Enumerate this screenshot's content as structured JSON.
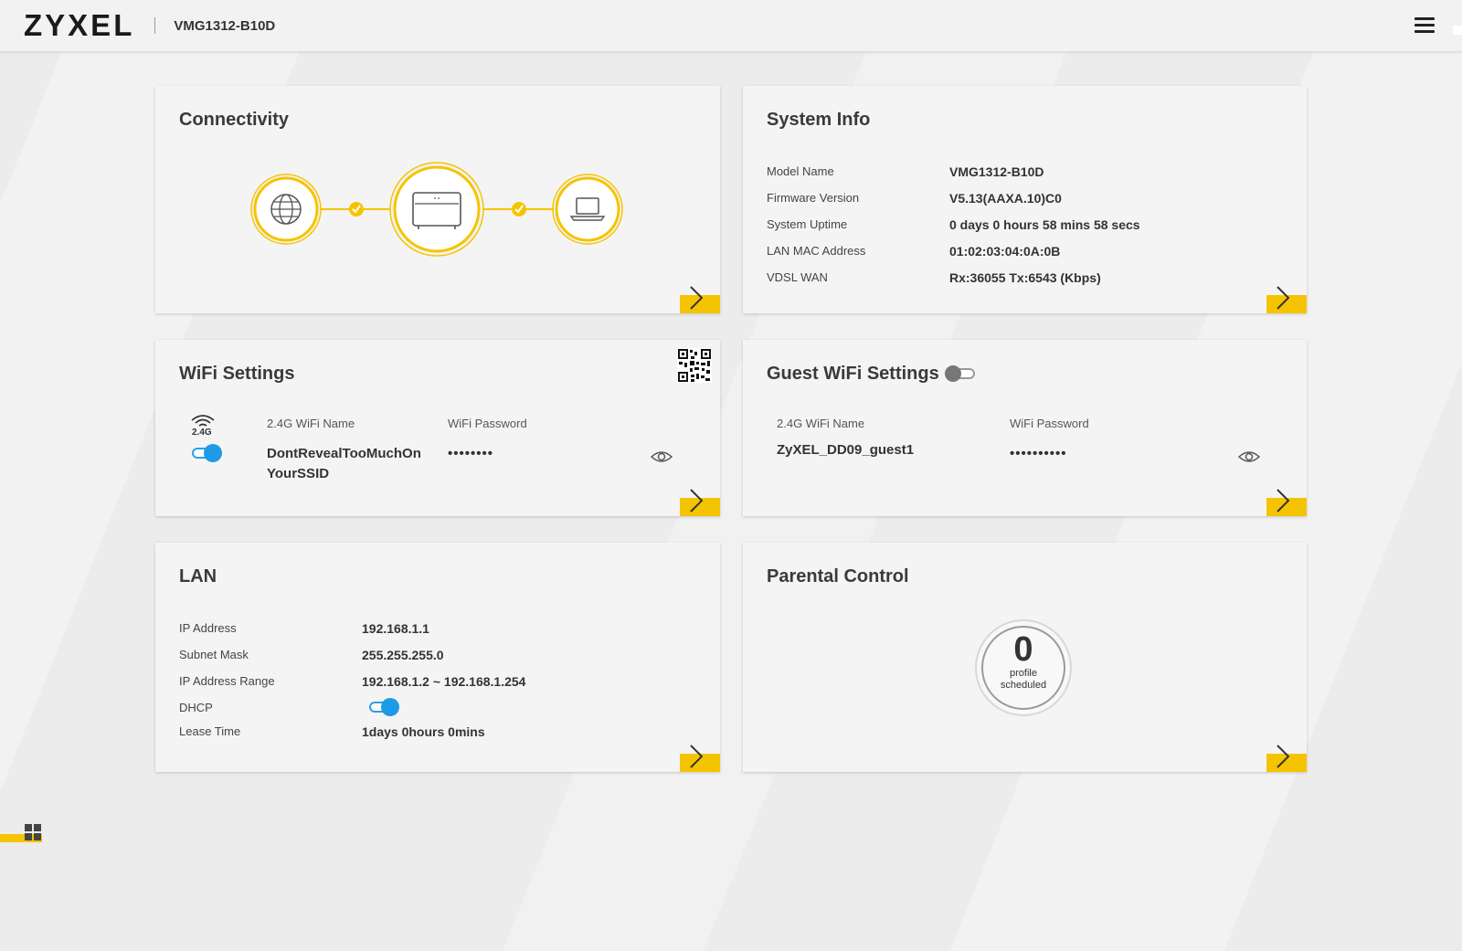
{
  "header": {
    "logo": "ZYXEL",
    "model": "VMG1312-B10D"
  },
  "colors": {
    "accent": "#f5c400",
    "toggle_on": "#1e9be6",
    "card_bg": "#f4f4f4"
  },
  "connectivity": {
    "title": "Connectivity",
    "nodes": [
      "globe-icon",
      "router-icon",
      "laptop-icon"
    ]
  },
  "system_info": {
    "title": "System Info",
    "rows": [
      {
        "label": "Model Name",
        "value": "VMG1312-B10D"
      },
      {
        "label": "Firmware Version",
        "value": "V5.13(AAXA.10)C0"
      },
      {
        "label": "System Uptime",
        "value": "0 days 0 hours 58 mins 58 secs"
      },
      {
        "label": "LAN MAC Address",
        "value": "01:02:03:04:0A:0B"
      },
      {
        "label": "VDSL WAN",
        "value": "Rx:36055 Tx:6543 (Kbps)"
      }
    ]
  },
  "wifi": {
    "title": "WiFi Settings",
    "band": "2.4G",
    "name_label": "2.4G WiFi Name",
    "name_line1": "DontRevealTooMuchOn",
    "name_line2": "YourSSID",
    "password_label": "WiFi Password",
    "password": "••••••••",
    "enabled": true
  },
  "guest_wifi": {
    "title": "Guest WiFi Settings",
    "enabled": false,
    "name_label": "2.4G WiFi Name",
    "name": "ZyXEL_DD09_guest1",
    "password_label": "WiFi Password",
    "password": "••••••••••"
  },
  "lan": {
    "title": "LAN",
    "ip_label": "IP Address",
    "ip": "192.168.1.1",
    "mask_label": "Subnet Mask",
    "mask": "255.255.255.0",
    "range_label": "IP Address Range",
    "range": "192.168.1.2 ~ 192.168.1.254",
    "dhcp_label": "DHCP",
    "dhcp_enabled": true,
    "lease_label": "Lease Time",
    "lease": "1days 0hours 0mins"
  },
  "parental": {
    "title": "Parental Control",
    "count": "0",
    "count_label_1": "profile",
    "count_label_2": "scheduled"
  }
}
